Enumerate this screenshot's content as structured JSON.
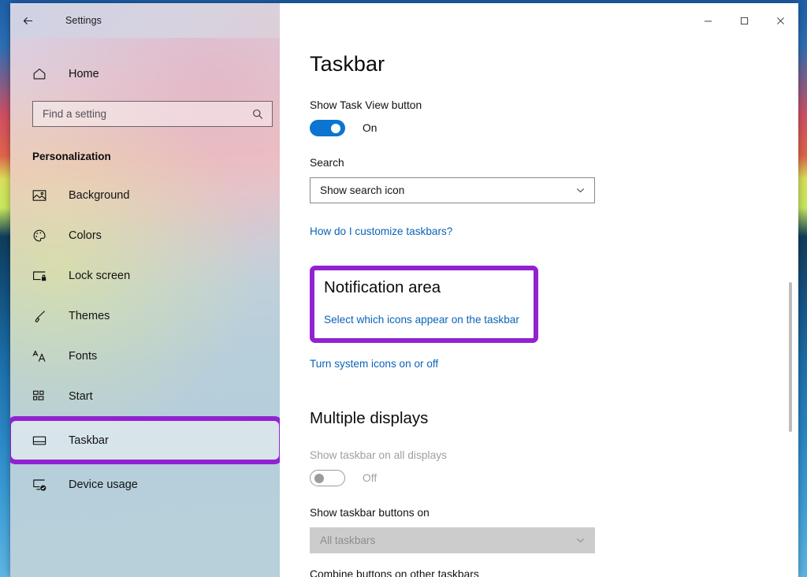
{
  "window": {
    "app_title": "Settings",
    "back_label": "Back",
    "minimize_label": "Minimize",
    "maximize_label": "Maximize",
    "close_label": "Close"
  },
  "sidebar": {
    "home_label": "Home",
    "search": {
      "placeholder": "Find a setting",
      "value": ""
    },
    "section_heading": "Personalization",
    "items": [
      {
        "label": "Background",
        "icon": "image-icon",
        "annotated": false
      },
      {
        "label": "Colors",
        "icon": "palette-icon",
        "annotated": false
      },
      {
        "label": "Lock screen",
        "icon": "lock-screen-icon",
        "annotated": false
      },
      {
        "label": "Themes",
        "icon": "brush-icon",
        "annotated": false
      },
      {
        "label": "Fonts",
        "icon": "fonts-icon",
        "annotated": false
      },
      {
        "label": "Start",
        "icon": "start-tiles-icon",
        "annotated": false
      },
      {
        "label": "Taskbar",
        "icon": "taskbar-icon",
        "annotated": true
      },
      {
        "label": "Device usage",
        "icon": "device-usage-icon",
        "annotated": false
      }
    ]
  },
  "main": {
    "page_title": "Taskbar",
    "task_view": {
      "label": "Show Task View button",
      "state": "On"
    },
    "search_setting": {
      "label": "Search",
      "value": "Show search icon"
    },
    "customize_link": "How do I customize taskbars?",
    "notification_area": {
      "title": "Notification area",
      "select_icons_link": "Select which icons appear on the taskbar"
    },
    "turn_system_icons_link": "Turn system icons on or off",
    "multiple_displays": {
      "title": "Multiple displays",
      "show_on_all": {
        "label": "Show taskbar on all displays",
        "state": "Off"
      },
      "buttons_on": {
        "label": "Show taskbar buttons on",
        "value": "All taskbars"
      },
      "combine_label": "Combine buttons on other taskbars"
    }
  },
  "colors": {
    "accent_blue": "#0b75cf",
    "link_blue": "#0b63b8",
    "annotation_purple": "#9221d1"
  }
}
